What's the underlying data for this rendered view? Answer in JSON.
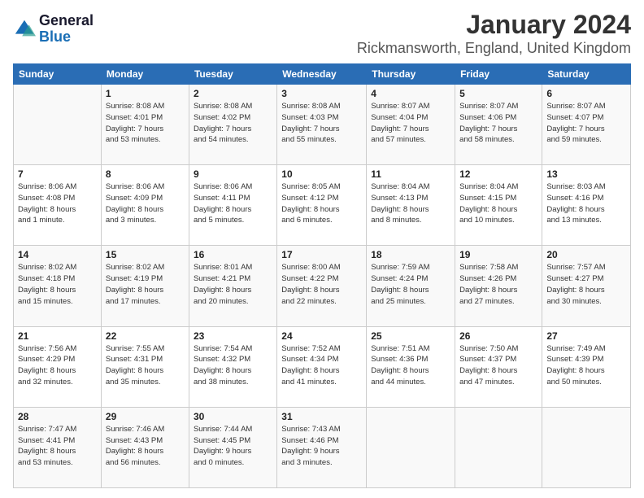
{
  "header": {
    "logo_general": "General",
    "logo_blue": "Blue",
    "month_title": "January 2024",
    "location": "Rickmansworth, England, United Kingdom"
  },
  "days_of_week": [
    "Sunday",
    "Monday",
    "Tuesday",
    "Wednesday",
    "Thursday",
    "Friday",
    "Saturday"
  ],
  "weeks": [
    [
      {
        "day": "",
        "info": ""
      },
      {
        "day": "1",
        "info": "Sunrise: 8:08 AM\nSunset: 4:01 PM\nDaylight: 7 hours\nand 53 minutes."
      },
      {
        "day": "2",
        "info": "Sunrise: 8:08 AM\nSunset: 4:02 PM\nDaylight: 7 hours\nand 54 minutes."
      },
      {
        "day": "3",
        "info": "Sunrise: 8:08 AM\nSunset: 4:03 PM\nDaylight: 7 hours\nand 55 minutes."
      },
      {
        "day": "4",
        "info": "Sunrise: 8:07 AM\nSunset: 4:04 PM\nDaylight: 7 hours\nand 57 minutes."
      },
      {
        "day": "5",
        "info": "Sunrise: 8:07 AM\nSunset: 4:06 PM\nDaylight: 7 hours\nand 58 minutes."
      },
      {
        "day": "6",
        "info": "Sunrise: 8:07 AM\nSunset: 4:07 PM\nDaylight: 7 hours\nand 59 minutes."
      }
    ],
    [
      {
        "day": "7",
        "info": "Sunrise: 8:06 AM\nSunset: 4:08 PM\nDaylight: 8 hours\nand 1 minute."
      },
      {
        "day": "8",
        "info": "Sunrise: 8:06 AM\nSunset: 4:09 PM\nDaylight: 8 hours\nand 3 minutes."
      },
      {
        "day": "9",
        "info": "Sunrise: 8:06 AM\nSunset: 4:11 PM\nDaylight: 8 hours\nand 5 minutes."
      },
      {
        "day": "10",
        "info": "Sunrise: 8:05 AM\nSunset: 4:12 PM\nDaylight: 8 hours\nand 6 minutes."
      },
      {
        "day": "11",
        "info": "Sunrise: 8:04 AM\nSunset: 4:13 PM\nDaylight: 8 hours\nand 8 minutes."
      },
      {
        "day": "12",
        "info": "Sunrise: 8:04 AM\nSunset: 4:15 PM\nDaylight: 8 hours\nand 10 minutes."
      },
      {
        "day": "13",
        "info": "Sunrise: 8:03 AM\nSunset: 4:16 PM\nDaylight: 8 hours\nand 13 minutes."
      }
    ],
    [
      {
        "day": "14",
        "info": "Sunrise: 8:02 AM\nSunset: 4:18 PM\nDaylight: 8 hours\nand 15 minutes."
      },
      {
        "day": "15",
        "info": "Sunrise: 8:02 AM\nSunset: 4:19 PM\nDaylight: 8 hours\nand 17 minutes."
      },
      {
        "day": "16",
        "info": "Sunrise: 8:01 AM\nSunset: 4:21 PM\nDaylight: 8 hours\nand 20 minutes."
      },
      {
        "day": "17",
        "info": "Sunrise: 8:00 AM\nSunset: 4:22 PM\nDaylight: 8 hours\nand 22 minutes."
      },
      {
        "day": "18",
        "info": "Sunrise: 7:59 AM\nSunset: 4:24 PM\nDaylight: 8 hours\nand 25 minutes."
      },
      {
        "day": "19",
        "info": "Sunrise: 7:58 AM\nSunset: 4:26 PM\nDaylight: 8 hours\nand 27 minutes."
      },
      {
        "day": "20",
        "info": "Sunrise: 7:57 AM\nSunset: 4:27 PM\nDaylight: 8 hours\nand 30 minutes."
      }
    ],
    [
      {
        "day": "21",
        "info": "Sunrise: 7:56 AM\nSunset: 4:29 PM\nDaylight: 8 hours\nand 32 minutes."
      },
      {
        "day": "22",
        "info": "Sunrise: 7:55 AM\nSunset: 4:31 PM\nDaylight: 8 hours\nand 35 minutes."
      },
      {
        "day": "23",
        "info": "Sunrise: 7:54 AM\nSunset: 4:32 PM\nDaylight: 8 hours\nand 38 minutes."
      },
      {
        "day": "24",
        "info": "Sunrise: 7:52 AM\nSunset: 4:34 PM\nDaylight: 8 hours\nand 41 minutes."
      },
      {
        "day": "25",
        "info": "Sunrise: 7:51 AM\nSunset: 4:36 PM\nDaylight: 8 hours\nand 44 minutes."
      },
      {
        "day": "26",
        "info": "Sunrise: 7:50 AM\nSunset: 4:37 PM\nDaylight: 8 hours\nand 47 minutes."
      },
      {
        "day": "27",
        "info": "Sunrise: 7:49 AM\nSunset: 4:39 PM\nDaylight: 8 hours\nand 50 minutes."
      }
    ],
    [
      {
        "day": "28",
        "info": "Sunrise: 7:47 AM\nSunset: 4:41 PM\nDaylight: 8 hours\nand 53 minutes."
      },
      {
        "day": "29",
        "info": "Sunrise: 7:46 AM\nSunset: 4:43 PM\nDaylight: 8 hours\nand 56 minutes."
      },
      {
        "day": "30",
        "info": "Sunrise: 7:44 AM\nSunset: 4:45 PM\nDaylight: 9 hours\nand 0 minutes."
      },
      {
        "day": "31",
        "info": "Sunrise: 7:43 AM\nSunset: 4:46 PM\nDaylight: 9 hours\nand 3 minutes."
      },
      {
        "day": "",
        "info": ""
      },
      {
        "day": "",
        "info": ""
      },
      {
        "day": "",
        "info": ""
      }
    ]
  ]
}
